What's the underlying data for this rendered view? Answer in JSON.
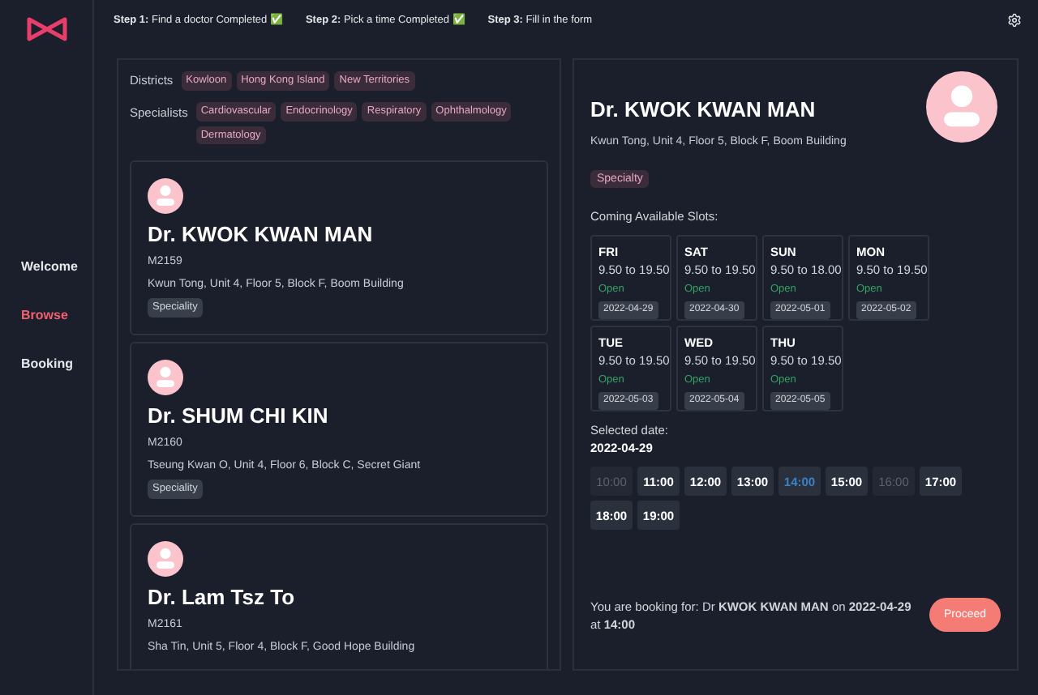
{
  "steps": [
    "**Step 1:** Find a doctor Completed ✅",
    "**Step 2:** Pick a time Completed ✅",
    "**Step 3:** Fill in the form"
  ],
  "sidebar": {
    "items": [
      {
        "label": "Welcome",
        "selected": false
      },
      {
        "label": "Browse",
        "selected": true
      },
      {
        "label": "Booking",
        "selected": false
      }
    ]
  },
  "filters": {
    "districts_label": "Districts",
    "districts": [
      "Kowloon",
      "Hong Kong Island",
      "New Territories"
    ],
    "specialists_label": "Specialists",
    "specialists": [
      "Cardiovascular",
      "Endocrinology",
      "Respiratory",
      "Ophthalmology",
      "Dermatology"
    ]
  },
  "doctors": [
    {
      "name": "Dr. KWOK KWAN MAN",
      "code": "M2159",
      "address": "Kwun Tong, Unit 4, Floor 5, Block F, Boom Building",
      "badge": "Speciality"
    },
    {
      "name": "Dr. SHUM CHI KIN",
      "code": "M2160",
      "address": "Tseung Kwan O, Unit 4, Floor 6, Block C, Secret Giant",
      "badge": "Speciality"
    },
    {
      "name": "Dr. Lam Tsz To",
      "code": "M2161",
      "address": "Sha Tin, Unit 5, Floor 4, Block F, Good Hope Building"
    }
  ],
  "detail": {
    "name": "Dr. KWOK KWAN MAN",
    "address": "Kwun Tong, Unit 4, Floor 5, Block F, Boom Building",
    "badge": "Specialty",
    "slots_title": "Coming Available Slots:",
    "days": [
      {
        "day": "FRI",
        "hours": "9.50 to 19.50",
        "status": "Open",
        "date": "2022-04-29"
      },
      {
        "day": "SAT",
        "hours": "9.50 to 19.50",
        "status": "Open",
        "date": "2022-04-30"
      },
      {
        "day": "SUN",
        "hours": "9.50 to 18.00",
        "status": "Open",
        "date": "2022-05-01"
      },
      {
        "day": "MON",
        "hours": "9.50 to 19.50",
        "status": "Open",
        "date": "2022-05-02"
      },
      {
        "day": "TUE",
        "hours": "9.50 to 19.50",
        "status": "Open",
        "date": "2022-05-03"
      },
      {
        "day": "WED",
        "hours": "9.50 to 19.50",
        "status": "Open",
        "date": "2022-05-04"
      },
      {
        "day": "THU",
        "hours": "9.50 to 19.50",
        "status": "Open",
        "date": "2022-05-05"
      }
    ],
    "selected_date_label": "Selected date:",
    "selected_date": "2022-04-29",
    "times": [
      {
        "label": "10:00",
        "disabled": true,
        "selected": false
      },
      {
        "label": "11:00",
        "disabled": false,
        "selected": false
      },
      {
        "label": "12:00",
        "disabled": false,
        "selected": false
      },
      {
        "label": "13:00",
        "disabled": false,
        "selected": false
      },
      {
        "label": "14:00",
        "disabled": false,
        "selected": true
      },
      {
        "label": "15:00",
        "disabled": false,
        "selected": false
      },
      {
        "label": "16:00",
        "disabled": true,
        "selected": false
      },
      {
        "label": "17:00",
        "disabled": false,
        "selected": false
      },
      {
        "label": "18:00",
        "disabled": false,
        "selected": false
      },
      {
        "label": "19:00",
        "disabled": false,
        "selected": false
      }
    ],
    "summary": "You are booking for: Dr **KWOK KWAN MAN** on **2022-04-29** at **14:00**",
    "proceed": "Proceed"
  }
}
